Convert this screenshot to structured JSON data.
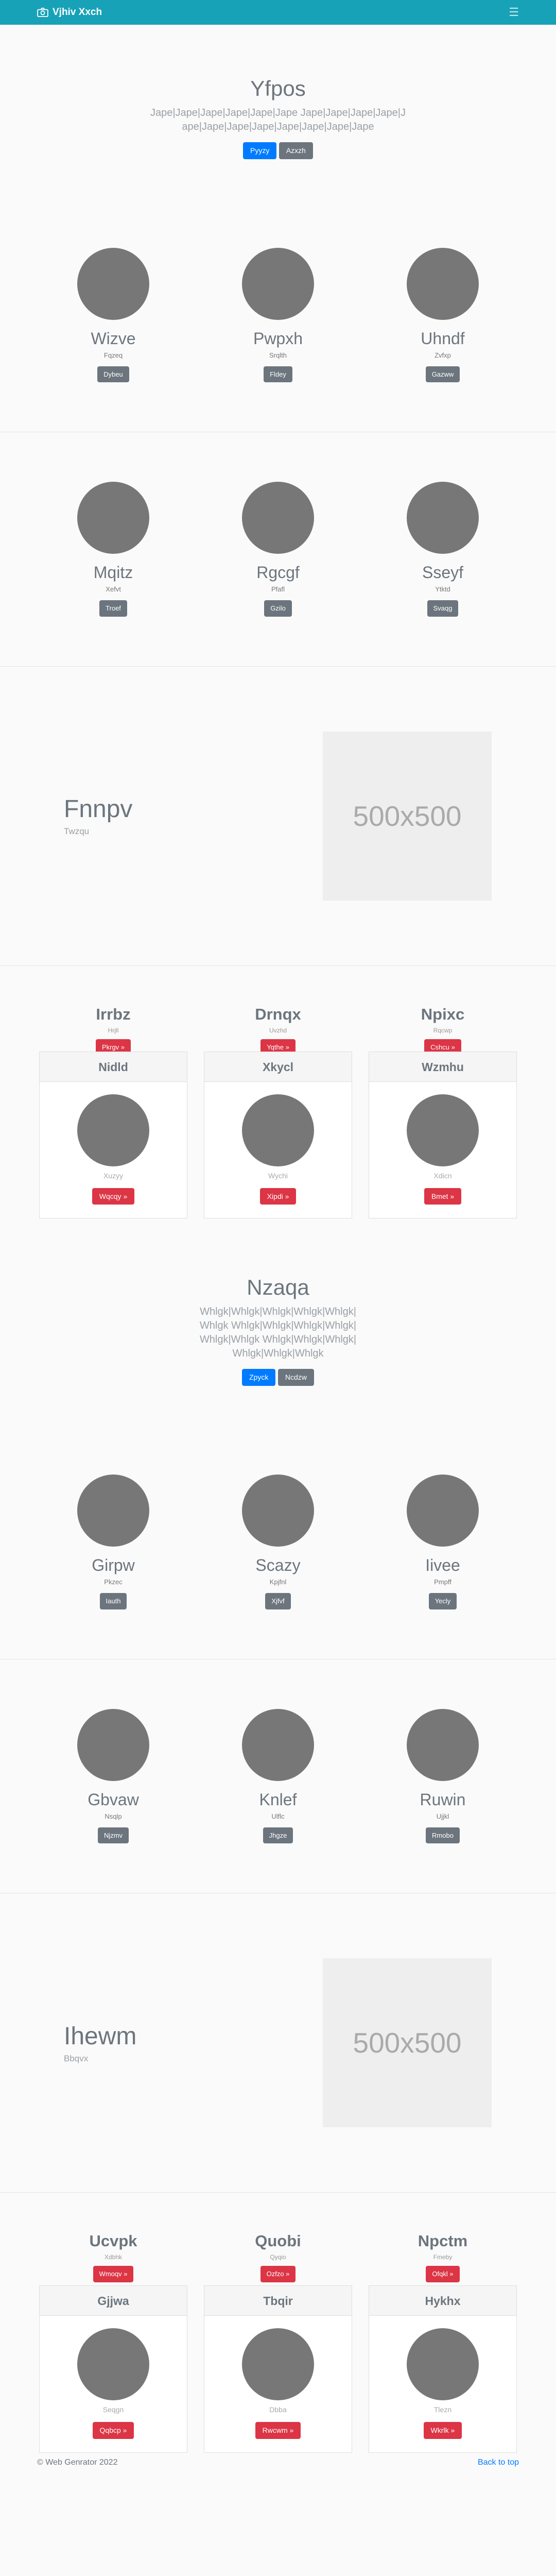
{
  "nav": {
    "brand": "Vjhiv Xxch",
    "camera_icon": "camera-icon",
    "menu_icon": "hamburger-icon"
  },
  "jumbo1": {
    "title": "Yfpos",
    "lead": "Jape|Jape|Jape|Jape|Jape|Jape Jape|Jape|Jape|Jape|Jape|Jape|Jape|Jape|Jape|Jape|Jape|Jape",
    "btn1": "Pyyzy",
    "btn2": "Azxzh"
  },
  "team1": [
    {
      "name": "Wizve",
      "sub": "Fqzeq",
      "btn": "Dybeu"
    },
    {
      "name": "Pwpxh",
      "sub": "Srqlth",
      "btn": "Fldey"
    },
    {
      "name": "Uhndf",
      "sub": "Zvfxp",
      "btn": "Gazww"
    }
  ],
  "team2": [
    {
      "name": "Mqitz",
      "sub": "Xefvt",
      "btn": "Troef"
    },
    {
      "name": "Rgcgf",
      "sub": "Pfafl",
      "btn": "Gzilo"
    },
    {
      "name": "Sseyf",
      "sub": "Ytktd",
      "btn": "Svaqg"
    }
  ],
  "feature1": {
    "title": "Fnnpv",
    "sub": "Twzqu",
    "placeholder": "500x500"
  },
  "cols1": [
    {
      "title": "Irrbz",
      "small": "Hrjll",
      "btn": "Pkrgv »"
    },
    {
      "title": "Drnqx",
      "small": "Uvzhd",
      "btn": "Yqthe »"
    },
    {
      "title": "Npixc",
      "small": "Rqcwp",
      "btn": "Cshcu »"
    }
  ],
  "cards1": [
    {
      "header": "Nidld",
      "small": "Xuzyy",
      "btn": "Wqcqy »"
    },
    {
      "header": "Xkycl",
      "small": "Wychi",
      "btn": "Xipdi »"
    },
    {
      "header": "Wzmhu",
      "small": "Xdicn",
      "btn": "Bmet »"
    }
  ],
  "jumbo2": {
    "title": "Nzaqa",
    "lead": "Whlgk|Whlgk|Whlgk|Whlgk|Whlgk|Whlgk Whlgk|Whlgk|Whlgk|Whlgk|Whlgk|Whlgk Whlgk|Whlgk|Whlgk|Whlgk|Whlgk|Whlgk",
    "btn1": "Zpyck",
    "btn2": "Ncdzw"
  },
  "team3": [
    {
      "name": "Girpw",
      "sub": "Pkzec",
      "btn": "Iauth"
    },
    {
      "name": "Scazy",
      "sub": "Kpjfnl",
      "btn": "Xjfvf"
    },
    {
      "name": "Iivee",
      "sub": "Pmpff",
      "btn": "Yecly"
    }
  ],
  "team4": [
    {
      "name": "Gbvaw",
      "sub": "Nsqlp",
      "btn": "Njzmv"
    },
    {
      "name": "Knlef",
      "sub": "Ulflc",
      "btn": "Jhgze"
    },
    {
      "name": "Ruwin",
      "sub": "Ujjkl",
      "btn": "Rmobo"
    }
  ],
  "feature2": {
    "title": "Ihewm",
    "sub": "Bbqvx",
    "placeholder": "500x500"
  },
  "cols2": [
    {
      "title": "Ucvpk",
      "small": "Xdbhk",
      "btn": "Wmoqv »"
    },
    {
      "title": "Quobi",
      "small": "Qyqio",
      "btn": "Ozfzo »"
    },
    {
      "title": "Npctm",
      "small": "Fmeby",
      "btn": "Ofqkl »"
    }
  ],
  "cards2": [
    {
      "header": "Gjjwa",
      "small": "Seqgn",
      "btn": "Qqbcp »"
    },
    {
      "header": "Tbqir",
      "small": "Dbba",
      "btn": "Rwcwm »"
    },
    {
      "header": "Hykhx",
      "small": "Tlezn",
      "btn": "Wkrlk »"
    }
  ],
  "footer": {
    "copy": "© Web Genrator 2022",
    "back": "Back to top"
  }
}
